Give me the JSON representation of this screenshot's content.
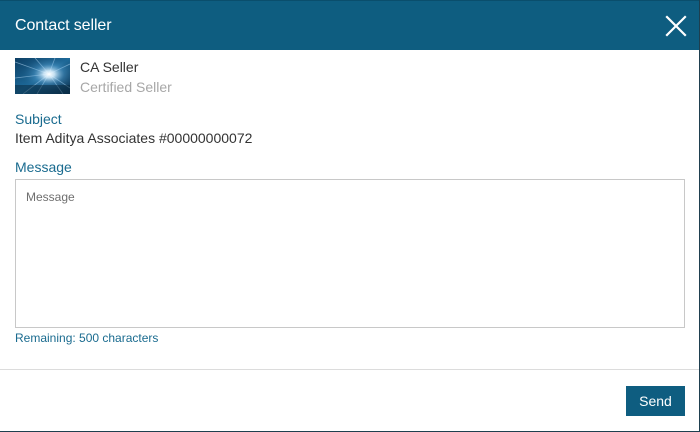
{
  "dialog": {
    "title": "Contact seller",
    "close_icon": "close-icon",
    "colors": {
      "header_bg": "#0e5d80",
      "label": "#1a6b8f",
      "button_bg": "#0e5d80"
    }
  },
  "seller": {
    "image": "seller-thumbnail-starburst",
    "name": "CA Seller",
    "status": "Certified Seller"
  },
  "subject": {
    "label": "Subject",
    "value": "Item Aditya Associates #00000000072"
  },
  "message": {
    "label": "Message",
    "placeholder": "Message",
    "value": "",
    "remaining_text": "Remaining: 500 characters"
  },
  "footer": {
    "send_label": "Send"
  }
}
